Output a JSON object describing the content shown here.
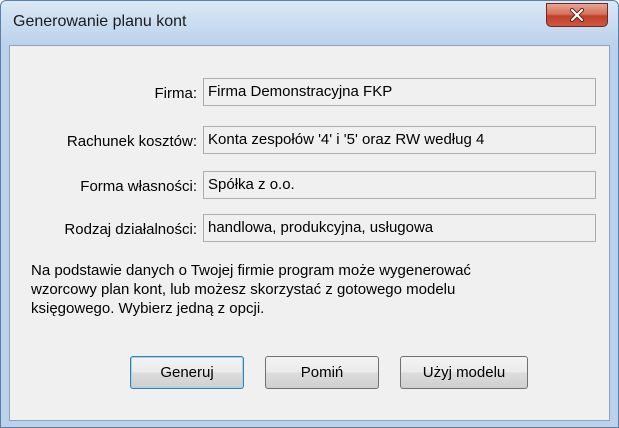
{
  "window": {
    "title": "Generowanie planu kont"
  },
  "fields": [
    {
      "label": "Firma:",
      "value": "Firma Demonstracyjna FKP"
    },
    {
      "label": "Rachunek kosztów:",
      "value": "Konta zespołów '4' i '5' oraz RW według 4"
    },
    {
      "label": "Forma własności:",
      "value": "Spółka z o.o."
    },
    {
      "label": "Rodzaj działalności:",
      "value": "handlowa, produkcyjna, usługowa"
    }
  ],
  "info": {
    "lines": [
      "Na podstawie danych o Twojej firmie program może wygenerować",
      "wzorcowy plan kont, lub możesz skorzystać z gotowego modelu",
      "księgowego. Wybierz jedną z opcji."
    ]
  },
  "buttons": {
    "generate": "Generuj",
    "skip": "Pomiń",
    "use_model": "Użyj modelu"
  },
  "icons": {
    "close": "close-icon"
  },
  "colors": {
    "title_bar": "#c5d9ef",
    "close_button": "#c0412a",
    "dialog_background": "#f0f0f0"
  }
}
